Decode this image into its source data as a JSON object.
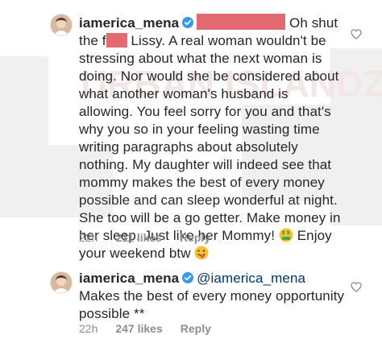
{
  "watermark": {
    "text": "URBAN ISLANDZ"
  },
  "comments": [
    {
      "username": "iamerica_mena",
      "text_part1": "Oh shut the f",
      "text_part2": " Lissy. A real woman wouldn't be stressing about what the next woman is doing. Nor would she be considered about what another woman's husband is allowing. You feel sorry for you and that's why you so in your feeling wasting time writing paragraphs about absolutely nothing. My daughter will indeed see that mommy makes the best of every money possible and can sleep wonderful at night. She too will be a go getter. Make money in her sleep. Just like her Mommy! ",
      "text_part3": " Enjoy your weekend btw ",
      "emoji1": "money-mouth-face",
      "emoji2": "winking-tongue-face",
      "time": "22h",
      "likes": "211 likes",
      "reply": "Reply"
    },
    {
      "username": "iamerica_mena",
      "mention": "@iamerica_mena",
      "text": " Makes the best of every money opportunity possible **",
      "time": "22h",
      "likes": "247 likes",
      "reply": "Reply"
    }
  ],
  "colors": {
    "verified": "#3897f0",
    "redaction": "#e36a70",
    "meta": "#8e8e8e",
    "mention": "#00376b"
  }
}
